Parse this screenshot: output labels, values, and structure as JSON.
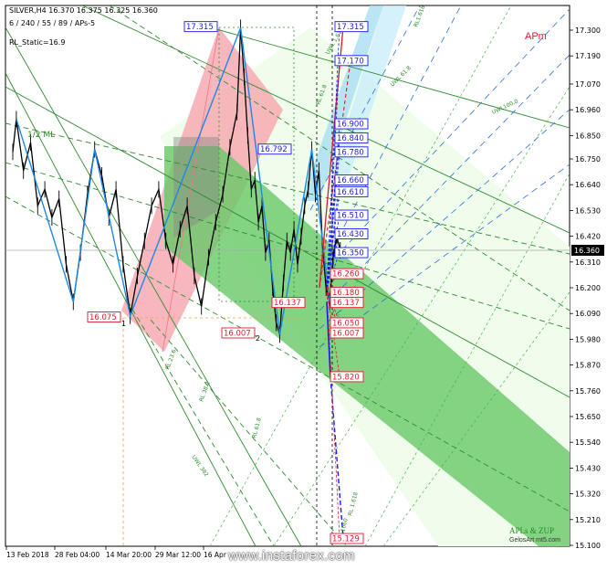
{
  "header": {
    "symbol_line": "SILVER,H4  16.370 16.375 16.325 16.360",
    "params_line": "6 / 240 / 55 / 89 / APs-5",
    "indicator_line": "RL_Static=16.9"
  },
  "apm_label": "APm",
  "ruler_label": "APLs & ZUP",
  "subtitle": "GelosArt mt5.com",
  "watermark": "www.instaforex.com",
  "chart_data": {
    "type": "line",
    "title": "",
    "ylim": [
      15.1,
      17.4
    ],
    "y_ticks": [
      17.3,
      17.19,
      17.07,
      16.96,
      16.85,
      16.75,
      16.64,
      16.53,
      16.42,
      16.31,
      16.2,
      16.09,
      15.98,
      15.87,
      15.76,
      15.65,
      15.54,
      15.43,
      15.32,
      15.21,
      15.1
    ],
    "y_tick_labels": [
      "17.300",
      "17.190",
      "17.070",
      "16.960",
      "16.850",
      "16.750",
      "16.640",
      "16.530",
      "16.420",
      "16.310",
      "16.200",
      "16.090",
      "15.980",
      "15.870",
      "15.760",
      "15.650",
      "15.540",
      "15.430",
      "15.320",
      "15.210",
      "15.100"
    ],
    "current_price": 16.36,
    "current_price_label": "16.360",
    "x_tick_labels": [
      "13 Feb 2018",
      "28 Feb 04:00",
      "14 Mar 20:00",
      "29 Mar 12:00",
      "16 Apr"
    ],
    "price_series": {
      "name": "SILVER,H4",
      "points": [
        [
          0,
          16.78
        ],
        [
          1,
          16.92
        ],
        [
          3,
          16.7
        ],
        [
          5,
          16.82
        ],
        [
          7,
          16.55
        ],
        [
          9,
          16.62
        ],
        [
          11,
          16.5
        ],
        [
          13,
          16.58
        ],
        [
          15,
          16.3
        ],
        [
          17,
          16.14
        ],
        [
          19,
          16.35
        ],
        [
          21,
          16.6
        ],
        [
          23,
          16.79
        ],
        [
          25,
          16.68
        ],
        [
          27,
          16.5
        ],
        [
          29,
          16.62
        ],
        [
          31,
          16.3
        ],
        [
          33,
          16.08
        ],
        [
          35,
          16.25
        ],
        [
          37,
          16.4
        ],
        [
          39,
          16.55
        ],
        [
          41,
          16.62
        ],
        [
          43,
          16.4
        ],
        [
          45,
          16.3
        ],
        [
          47,
          16.45
        ],
        [
          49,
          16.55
        ],
        [
          51,
          16.25
        ],
        [
          53,
          16.12
        ],
        [
          55,
          16.33
        ],
        [
          57,
          16.48
        ],
        [
          59,
          16.6
        ],
        [
          61,
          16.8
        ],
        [
          63,
          16.95
        ],
        [
          64,
          17.31
        ],
        [
          65,
          17.1
        ],
        [
          66,
          16.85
        ],
        [
          67,
          16.62
        ],
        [
          68,
          16.66
        ],
        [
          69,
          16.48
        ],
        [
          70,
          16.55
        ],
        [
          71,
          16.35
        ],
        [
          72,
          16.4
        ],
        [
          73,
          16.2
        ],
        [
          74,
          16.05
        ],
        [
          75,
          16.0
        ],
        [
          76,
          16.22
        ],
        [
          77,
          16.4
        ],
        [
          78,
          16.35
        ],
        [
          79,
          16.45
        ],
        [
          80,
          16.3
        ],
        [
          81,
          16.42
        ],
        [
          82,
          16.55
        ],
        [
          83,
          16.62
        ],
        [
          84,
          16.79
        ],
        [
          85,
          16.6
        ],
        [
          86,
          16.7
        ],
        [
          87,
          16.38
        ],
        [
          88,
          16.2
        ],
        [
          89,
          16.14
        ],
        [
          90,
          16.33
        ],
        [
          91,
          16.42
        ],
        [
          92,
          16.36
        ]
      ]
    },
    "zigzag": {
      "name": "ZUP",
      "points": [
        [
          1,
          16.92
        ],
        [
          17,
          16.14
        ],
        [
          23,
          16.79
        ],
        [
          33,
          16.08
        ],
        [
          64,
          17.31
        ],
        [
          75,
          16.0
        ],
        [
          84,
          16.79
        ],
        [
          89,
          16.14
        ]
      ]
    },
    "price_labels_left": [
      {
        "value": 17.315,
        "label": "17.315",
        "color": "#1a1aee"
      },
      {
        "value": 16.792,
        "label": "16.792",
        "color": "#1a1aee"
      },
      {
        "value": 16.137,
        "label": "16.137",
        "color": "#e0192b"
      },
      {
        "value": 16.075,
        "label": "16.075",
        "color": "#e0192b"
      },
      {
        "value": 16.007,
        "label": "16.007",
        "color": "#e0192b"
      }
    ],
    "price_labels_right": [
      {
        "value": 17.315,
        "label": "17.315",
        "color": "#1a1aee"
      },
      {
        "value": 17.17,
        "label": "17.170",
        "color": "#1a1aee"
      },
      {
        "value": 16.9,
        "label": "16.900",
        "color": "#1a1aee"
      },
      {
        "value": 16.84,
        "label": "16.840",
        "color": "#1a1aee"
      },
      {
        "value": 16.78,
        "label": "16.780",
        "color": "#1a1aee"
      },
      {
        "value": 16.66,
        "label": "16.660",
        "color": "#1a1aee"
      },
      {
        "value": 16.61,
        "label": "16.610",
        "color": "#1a1aee"
      },
      {
        "value": 16.51,
        "label": "16.510",
        "color": "#1a1aee"
      },
      {
        "value": 16.43,
        "label": "16.430",
        "color": "#1a1aee"
      },
      {
        "value": 16.35,
        "label": "16.350",
        "color": "#1a1aee"
      },
      {
        "value": 16.26,
        "label": "16.260",
        "color": "#e0192b"
      },
      {
        "value": 16.18,
        "label": "16.180",
        "color": "#e0192b"
      },
      {
        "value": 16.137,
        "label": "16.137",
        "color": "#e0192b"
      },
      {
        "value": 16.05,
        "label": "16.050",
        "color": "#e0192b"
      },
      {
        "value": 16.007,
        "label": "16.007",
        "color": "#e0192b"
      },
      {
        "value": 15.82,
        "label": "15.820",
        "color": "#e0192b"
      },
      {
        "value": 15.129,
        "label": "15.129",
        "color": "#e0192b"
      }
    ],
    "line_labels": [
      "1/2 ML",
      "RL 23.6",
      "RL 38.2",
      "RL 61.8",
      "UWL 382",
      "UWL 61.8",
      "UWL100.0",
      "RL 61.8",
      "RL1.618",
      "UWL 1.618",
      "RL 1.618",
      "RL1660"
    ],
    "pivot_labels": [
      "1",
      "2"
    ],
    "colors": {
      "up_fan": "#1a1aee",
      "down_fan": "#e0192b",
      "green_channel": "#3cb43c",
      "pink_channel": "#f5a0aa",
      "cyan_channel": "#87ceeb"
    }
  }
}
